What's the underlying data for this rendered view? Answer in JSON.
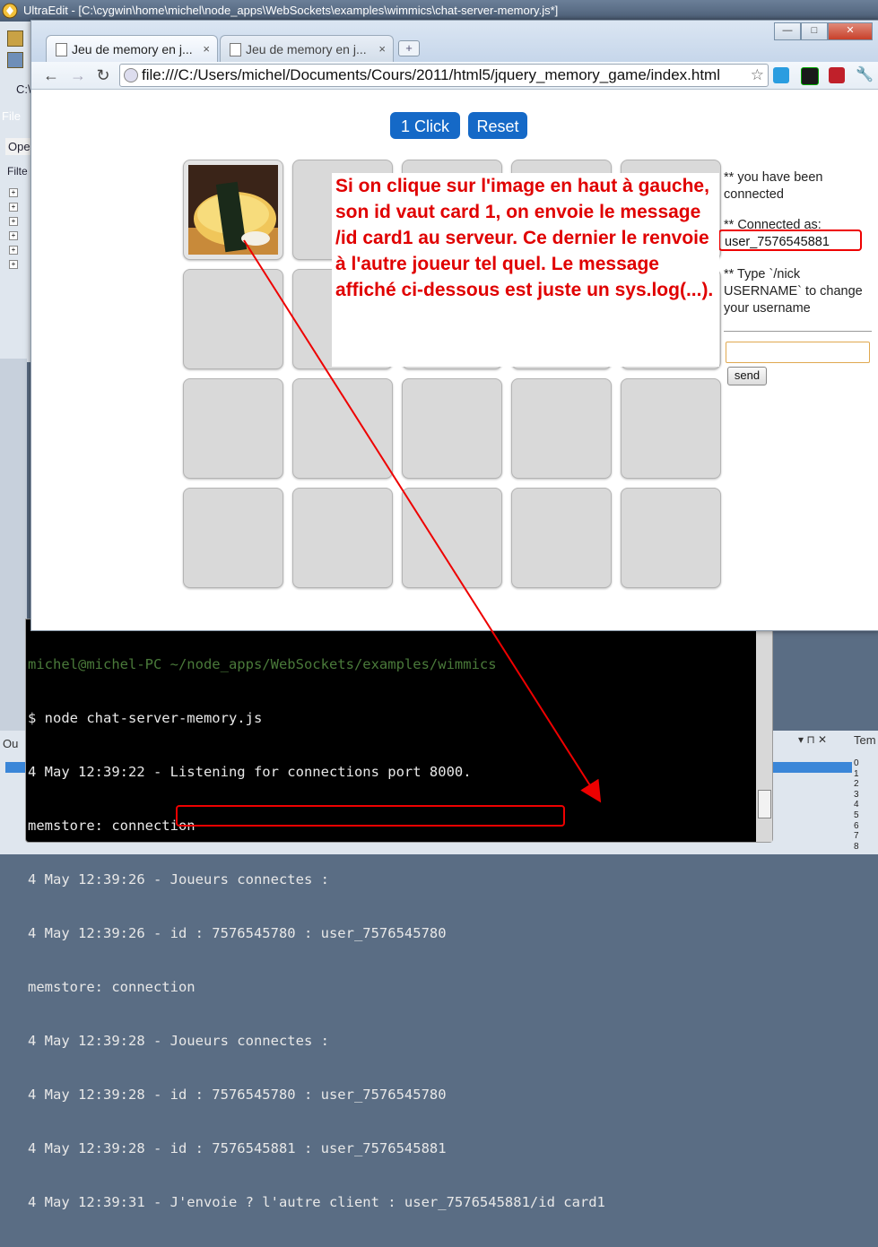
{
  "ultraedit": {
    "title": "UltraEdit - [C:\\cygwin\\home\\michel\\node_apps\\WebSockets\\examples\\wimmics\\chat-server-memory.js*]",
    "left_labels": [
      "File",
      "Ope",
      "Filte"
    ],
    "left_cv": "C:\\",
    "output_label": "Ou",
    "output_controls": "▾ ⊓ ✕",
    "tem_label": "Tem",
    "line_numbers": "0\n1\n2\n3\n4\n5\n6\n7\n8"
  },
  "browser": {
    "tabs": [
      {
        "label": "Jeu de memory en j...",
        "close": "×"
      },
      {
        "label": "Jeu de memory en j...",
        "close": "×"
      }
    ],
    "new_tab": "+",
    "window_controls": {
      "minimize": "—",
      "maximize": "□",
      "close": "✕"
    },
    "nav": {
      "back": "←",
      "forward": "→",
      "reload": "↻"
    },
    "url": "file:///C:/Users/michel/Documents/Cours/2011/html5/jquery_memory_game/index.html",
    "star": "☆"
  },
  "game": {
    "click_button": "1 Click",
    "reset_button": "Reset"
  },
  "chat": {
    "line1": "** you have been connected",
    "line2": "** Connected as:",
    "username": "user_7576545881",
    "line3": "** Type `/nick USERNAME` to change your username",
    "send_label": "send"
  },
  "annotation": {
    "text": "Si on clique sur l'image en haut à gauche, son id vaut card 1, on envoie le message /id card1 au serveur. Ce dernier le renvoie à l'autre joueur tel quel. Le message affiché ci-dessous est juste un sys.log(...)."
  },
  "terminal": {
    "prompt_partial": "michel@michel-PC ~/node_apps/WebSockets/examples/wimmics",
    "lines": [
      "$ node chat-server-memory.js",
      "4 May 12:39:22 - Listening for connections port 8000.",
      "memstore: connection",
      "4 May 12:39:26 - Joueurs connectes :",
      "4 May 12:39:26 - id : 7576545780 : user_7576545780",
      "memstore: connection",
      "4 May 12:39:28 - Joueurs connectes :",
      "4 May 12:39:28 - id : 7576545780 : user_7576545780",
      "4 May 12:39:28 - id : 7576545881 : user_7576545881",
      "4 May 12:39:31 - J'envoie ? l'autre client : user_7576545881/id card1"
    ]
  },
  "colors": {
    "accent_blue": "#1569c7",
    "annotation_red": "#e00000",
    "highlight_red": "#ee0000"
  }
}
